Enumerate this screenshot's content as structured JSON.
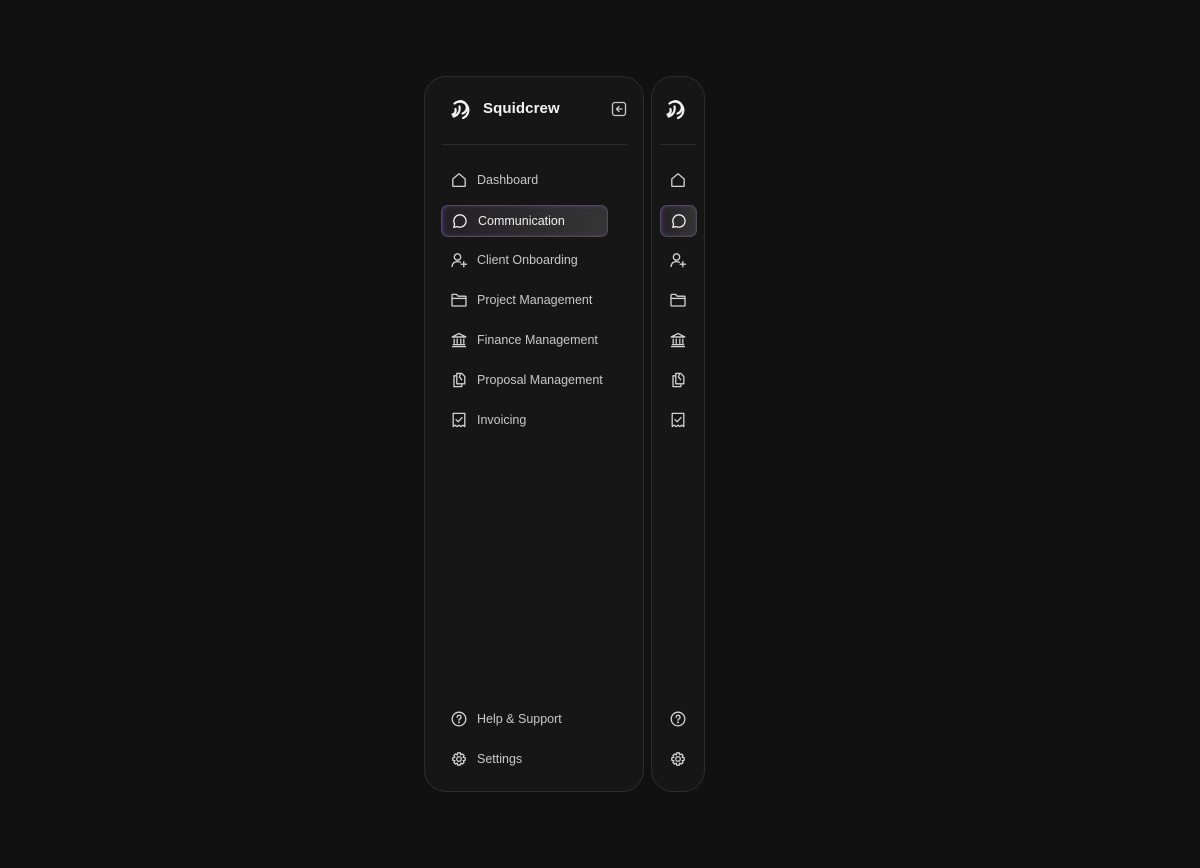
{
  "brand": {
    "name": "Squidcrew",
    "logo_icon": "squidcrew-logo-icon",
    "collapse_icon": "collapse-sidebar-icon"
  },
  "theme": {
    "background": "#111111",
    "panel": "#161616",
    "active_accent": "#844ede"
  },
  "nav": [
    {
      "id": "dashboard",
      "label": "Dashboard",
      "icon": "home-icon",
      "active": false
    },
    {
      "id": "communication",
      "label": "Communication",
      "icon": "chat-bubble-icon",
      "active": true
    },
    {
      "id": "client-onboarding",
      "label": "Client Onboarding",
      "icon": "user-plus-icon",
      "active": false
    },
    {
      "id": "project-management",
      "label": "Project Management",
      "icon": "folder-icon",
      "active": false
    },
    {
      "id": "finance-management",
      "label": "Finance Management",
      "icon": "bank-icon",
      "active": false
    },
    {
      "id": "proposal-management",
      "label": "Proposal Management",
      "icon": "documents-icon",
      "active": false
    },
    {
      "id": "invoicing",
      "label": "Invoicing",
      "icon": "receipt-check-icon",
      "active": false
    }
  ],
  "footer": [
    {
      "id": "help-support",
      "label": "Help & Support",
      "icon": "help-circle-icon"
    },
    {
      "id": "settings",
      "label": "Settings",
      "icon": "gear-icon"
    }
  ]
}
